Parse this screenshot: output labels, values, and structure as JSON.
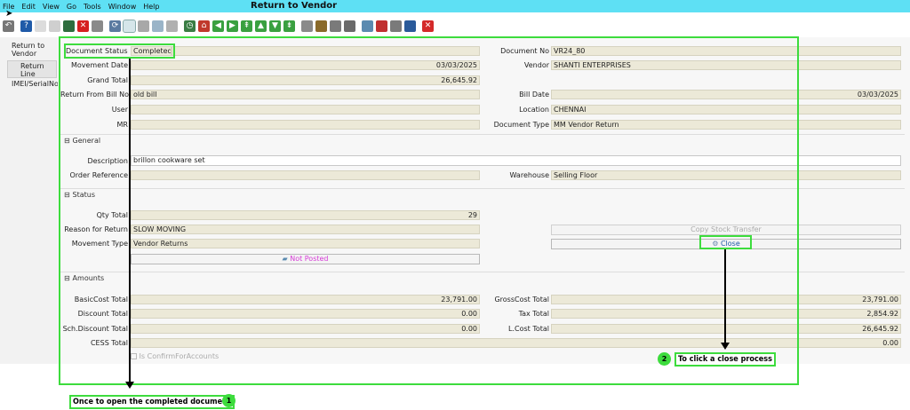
{
  "menu": [
    "File",
    "Edit",
    "View",
    "Go",
    "Tools",
    "Window",
    "Help"
  ],
  "app_title": "Return to Vendor",
  "toolbar_icons": [
    {
      "name": "undo-icon",
      "color": "#777777",
      "glyph": "↶"
    },
    {
      "name": "help-icon",
      "color": "#1f5aa8",
      "glyph": "?"
    },
    {
      "name": "new-record-icon",
      "color": "#dcdcdc",
      "glyph": ""
    },
    {
      "name": "copy-record-icon",
      "color": "#cfcfcf",
      "glyph": ""
    },
    {
      "name": "save-icon",
      "color": "#2e6d3e",
      "glyph": ""
    },
    {
      "name": "delete-icon",
      "color": "#d62020",
      "glyph": "✕"
    },
    {
      "name": "report-icon",
      "color": "#8a8a8a",
      "glyph": ""
    },
    {
      "name": "refresh-icon",
      "color": "#5a7aa0",
      "glyph": "⟳"
    },
    {
      "name": "find-icon",
      "color": "#7ea0b8",
      "glyph": ""
    },
    {
      "name": "attachment-icon",
      "color": "#a8a8a8",
      "glyph": ""
    },
    {
      "name": "chat-icon",
      "color": "#9ab4c8",
      "glyph": ""
    },
    {
      "name": "multi-record-icon",
      "color": "#b0b0b0",
      "glyph": ""
    },
    {
      "name": "history-icon",
      "color": "#3a7d44",
      "glyph": "◷"
    },
    {
      "name": "home-icon",
      "color": "#c0392b",
      "glyph": "⌂"
    },
    {
      "name": "previous-icon",
      "color": "#3aa040",
      "glyph": "◀"
    },
    {
      "name": "next-icon",
      "color": "#3aa040",
      "glyph": "▶"
    },
    {
      "name": "first-record-icon",
      "color": "#3aa040",
      "glyph": "⇞"
    },
    {
      "name": "previous-record-icon",
      "color": "#3aa040",
      "glyph": "▲"
    },
    {
      "name": "next-record-icon",
      "color": "#3aa040",
      "glyph": "▼"
    },
    {
      "name": "last-record-icon",
      "color": "#3aa040",
      "glyph": "⇟"
    },
    {
      "name": "archive-icon",
      "color": "#8a8a8a",
      "glyph": ""
    },
    {
      "name": "product-icon",
      "color": "#8a6a2a",
      "glyph": ""
    },
    {
      "name": "print-preview-icon",
      "color": "#7a7a7a",
      "glyph": ""
    },
    {
      "name": "print-icon",
      "color": "#6a6a6a",
      "glyph": ""
    },
    {
      "name": "zoom-icon",
      "color": "#5a8ab0",
      "glyph": ""
    },
    {
      "name": "workflow-icon",
      "color": "#c03030",
      "glyph": ""
    },
    {
      "name": "request-icon",
      "color": "#7a7a7a",
      "glyph": ""
    },
    {
      "name": "process-icon",
      "color": "#2a5a9a",
      "glyph": ""
    },
    {
      "name": "exit-icon",
      "color": "#d42a2a",
      "glyph": "✕"
    }
  ],
  "tabs": {
    "return_to_vendor": "Return to Vendor",
    "return_line": "Return Line",
    "imei": "IMEI/SerialNo"
  },
  "header": {
    "document_status_label": "Document Status",
    "document_status": "Completed",
    "document_no_label": "Document No",
    "document_no": "VR24_80",
    "movement_date_label": "Movement Date",
    "movement_date": "03/03/2025",
    "vendor_label": "Vendor",
    "vendor": "SHANTI ENTERPRISES",
    "grand_total_label": "Grand Total",
    "grand_total": "26,645.92",
    "return_from_bill_label": "Return From Bill No",
    "return_from_bill": "old bill",
    "bill_date_label": "Bill Date",
    "bill_date": "03/03/2025",
    "user_label": "User",
    "user": "",
    "location_label": "Location",
    "location": "CHENNAI",
    "mr_label": "MR",
    "mr": "",
    "document_type_label": "Document Type",
    "document_type": "MM Vendor Return"
  },
  "general": {
    "section": "General",
    "description_label": "Description",
    "description": "brillon cookware set",
    "order_reference_label": "Order Reference",
    "order_reference": "",
    "warehouse_label": "Warehouse",
    "warehouse": "Selling Floor"
  },
  "status": {
    "section": "Status",
    "qty_total_label": "Qty Total",
    "qty_total": "29",
    "reason_label": "Reason for Return",
    "reason": "SLOW MOVING",
    "copy_stock_transfer": "Copy Stock Transfer",
    "movement_type_label": "Movement Type",
    "movement_type": "Vendor Returns",
    "close_button": "Close",
    "not_posted_button": "Not Posted"
  },
  "amounts": {
    "section": "Amounts",
    "basic_cost_label": "BasicCost Total",
    "basic_cost": "23,791.00",
    "gross_cost_label": "GrossCost Total",
    "gross_cost": "23,791.00",
    "discount_label": "Discount Total",
    "discount": "0.00",
    "tax_label": "Tax Total",
    "tax": "2,854.92",
    "sch_discount_label": "Sch.Discount Total",
    "sch_discount": "0.00",
    "lcost_label": "L.Cost Total",
    "lcost": "26,645.92",
    "cess_label": "CESS Total",
    "cess": "0.00",
    "confirm_accounts": "Is ConfirmForAccounts"
  },
  "annotations": {
    "callout_1": "Once to open the completed document",
    "badge_1": "1",
    "callout_2": "To click a close process",
    "badge_2": "2"
  },
  "colors": {
    "titlebar": "#5ee0f4",
    "highlight": "#3ddc3d",
    "field_bg": "#ece9d8",
    "not_posted": "#d63cd6"
  }
}
